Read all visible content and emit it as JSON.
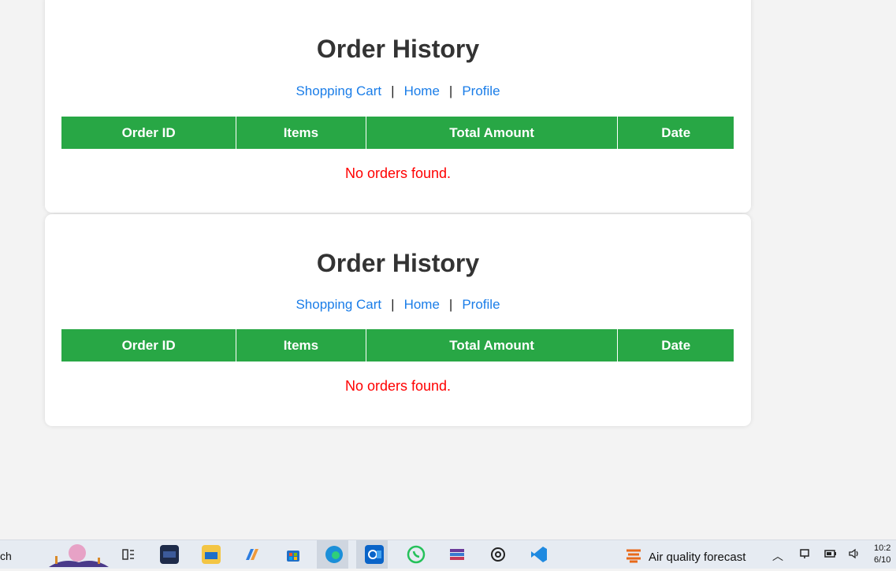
{
  "colors": {
    "header_bg": "#28a745",
    "link": "#1a7de8",
    "empty_text": "#ff0000",
    "title": "#333333"
  },
  "cards": [
    {
      "title": "Order History",
      "nav": {
        "cart": "Shopping Cart",
        "home": "Home",
        "profile": "Profile",
        "separator": "|"
      },
      "columns": [
        "Order ID",
        "Items",
        "Total Amount",
        "Date"
      ],
      "empty_message": "No orders found."
    },
    {
      "title": "Order History",
      "nav": {
        "cart": "Shopping Cart",
        "home": "Home",
        "profile": "Profile",
        "separator": "|"
      },
      "columns": [
        "Order ID",
        "Items",
        "Total Amount",
        "Date"
      ],
      "empty_message": "No orders found."
    }
  ],
  "taskbar": {
    "search_fragment": "ch",
    "icons": [
      "widgets-icon",
      "task-view-icon",
      "terminal-icon",
      "file-explorer-icon",
      "copilot-icon",
      "store-icon",
      "edge-icon",
      "outlook-icon",
      "whatsapp-icon",
      "winrar-icon",
      "chatgpt-icon",
      "vscode-icon"
    ],
    "weather": "Air quality forecast",
    "clock_time": "10:2",
    "clock_date": "6/10"
  }
}
